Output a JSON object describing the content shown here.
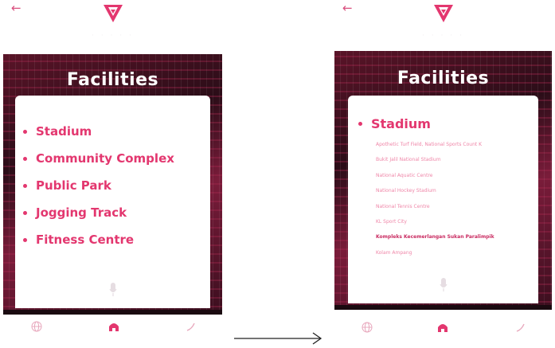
{
  "colors": {
    "accent": "#e3376f",
    "accent_light": "#ef86a8",
    "hero_dark": "#2b0d18",
    "white": "#ffffff"
  },
  "left_screen": {
    "header": {
      "back_icon": "back-arrow-icon",
      "logo_icon": "brand-v-logo-icon"
    },
    "hero": {
      "title": "Facilities"
    },
    "facilities": [
      {
        "label": "Stadium"
      },
      {
        "label": "Community Complex"
      },
      {
        "label": "Public Park"
      },
      {
        "label": "Jogging Track"
      },
      {
        "label": "Fitness Centre"
      }
    ],
    "mic_icon": "microphone-icon",
    "nav": [
      "globe-icon",
      "home-icon",
      "phone-icon"
    ]
  },
  "right_screen": {
    "header": {
      "back_icon": "back-arrow-icon",
      "logo_icon": "brand-v-logo-icon"
    },
    "hero": {
      "title": "Facilities"
    },
    "selected": {
      "label": "Stadium"
    },
    "stadiums": [
      {
        "label": "Apothetic Turf Field, National Sports Count K"
      },
      {
        "label": "Bukit Jalil National Stadium"
      },
      {
        "label": "National Aquatic Centre"
      },
      {
        "label": "National Hockey Stadium"
      },
      {
        "label": "National Tennis Centre"
      },
      {
        "label": "KL Sport City"
      },
      {
        "label": "Kompleks Kecemerlangan Sukan Paralimpik"
      },
      {
        "label": "Kolam Ampang"
      }
    ],
    "mic_icon": "microphone-icon",
    "nav": [
      "globe-icon",
      "home-icon",
      "phone-icon"
    ]
  },
  "transition_arrow": "right-arrow-icon"
}
